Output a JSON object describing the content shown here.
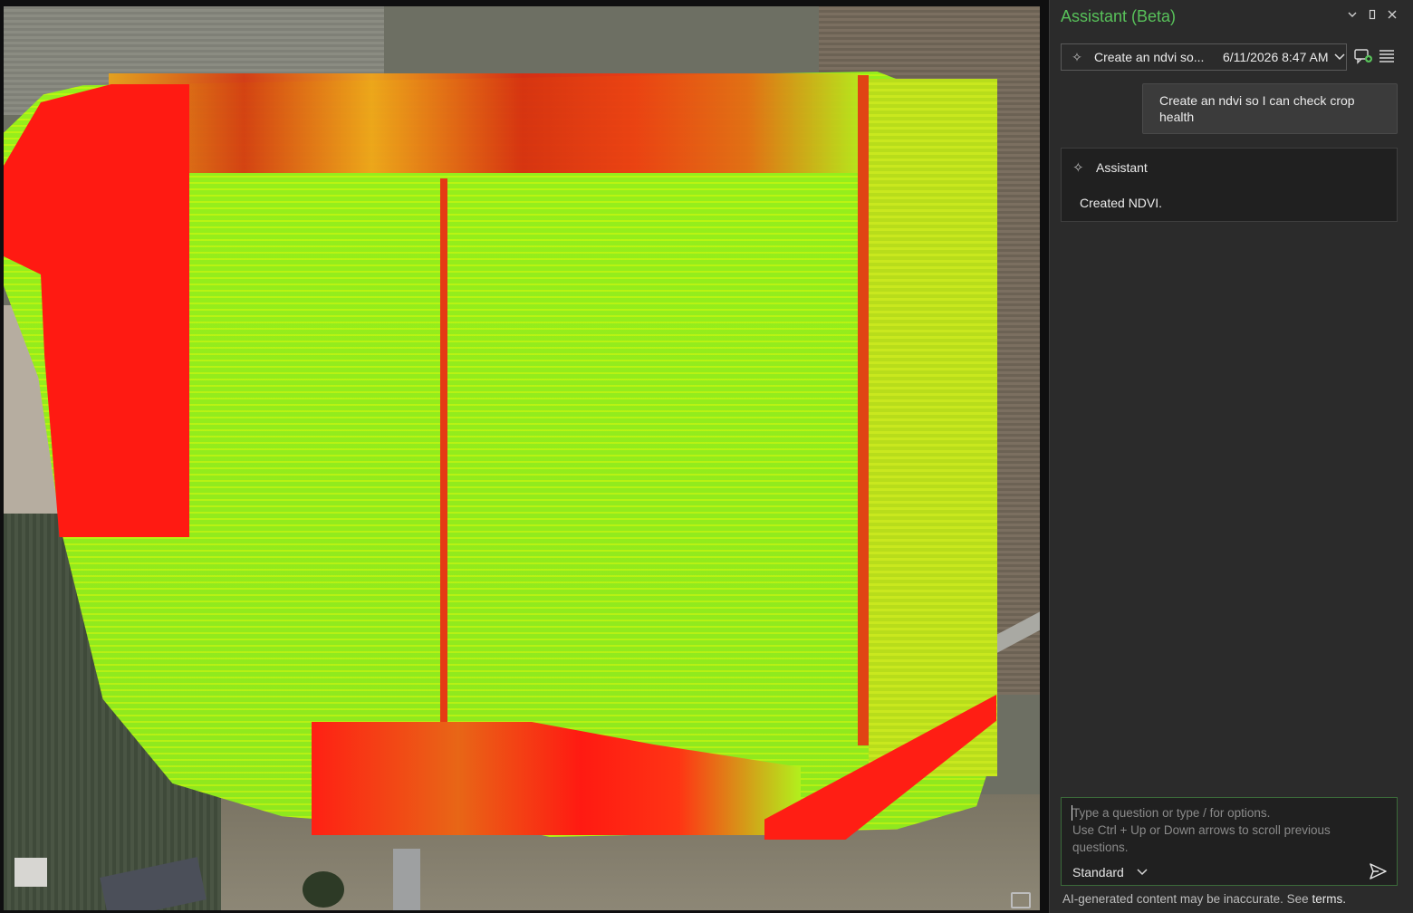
{
  "panel": {
    "title": "Assistant (Beta)",
    "window_buttons": [
      "chevron-down-icon",
      "restore-icon",
      "close-icon"
    ]
  },
  "session": {
    "name": "Create an ndvi so...",
    "datetime": "6/11/2026 8:47 AM"
  },
  "conversation": {
    "user_message": "Create an ndvi so I can check crop health",
    "assistant_label": "Assistant",
    "assistant_message": "Created NDVI."
  },
  "input": {
    "placeholder_line1": "Type a question or type / for options.",
    "placeholder_line2": "Use Ctrl + Up or Down arrows to scroll previous questions.",
    "mode": "Standard"
  },
  "footer": {
    "disclaimer": "AI-generated content may be inaccurate.",
    "see": "See",
    "terms_link": "terms."
  },
  "colors": {
    "accent": "#58c15a",
    "ndvi_high": "#96ef1c",
    "ndvi_low": "#ff1a12"
  }
}
